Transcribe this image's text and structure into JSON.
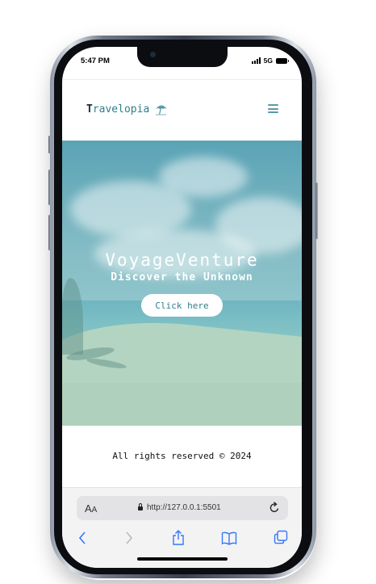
{
  "status": {
    "time": "5:47 PM",
    "network": "5G"
  },
  "navbar": {
    "brand_first": "T",
    "brand_rest": "ravelopia",
    "brand_icon": "umbrella-icon",
    "menu_icon": "hamburger-menu-icon"
  },
  "hero": {
    "title": "VoyageVenture",
    "subtitle": "Discover the Unknown",
    "button_label": "Click here"
  },
  "footer": {
    "text": "All rights reserved © 2024"
  },
  "browser": {
    "text_size_label": "A",
    "text_size_small": "A",
    "url": "http://127.0.0.1:5501"
  },
  "colors": {
    "accent": "#2f7f8a",
    "hero_top": "#5aa3b6",
    "hero_bottom": "#a8d0bd",
    "toolbar_icon": "#3478f6"
  }
}
